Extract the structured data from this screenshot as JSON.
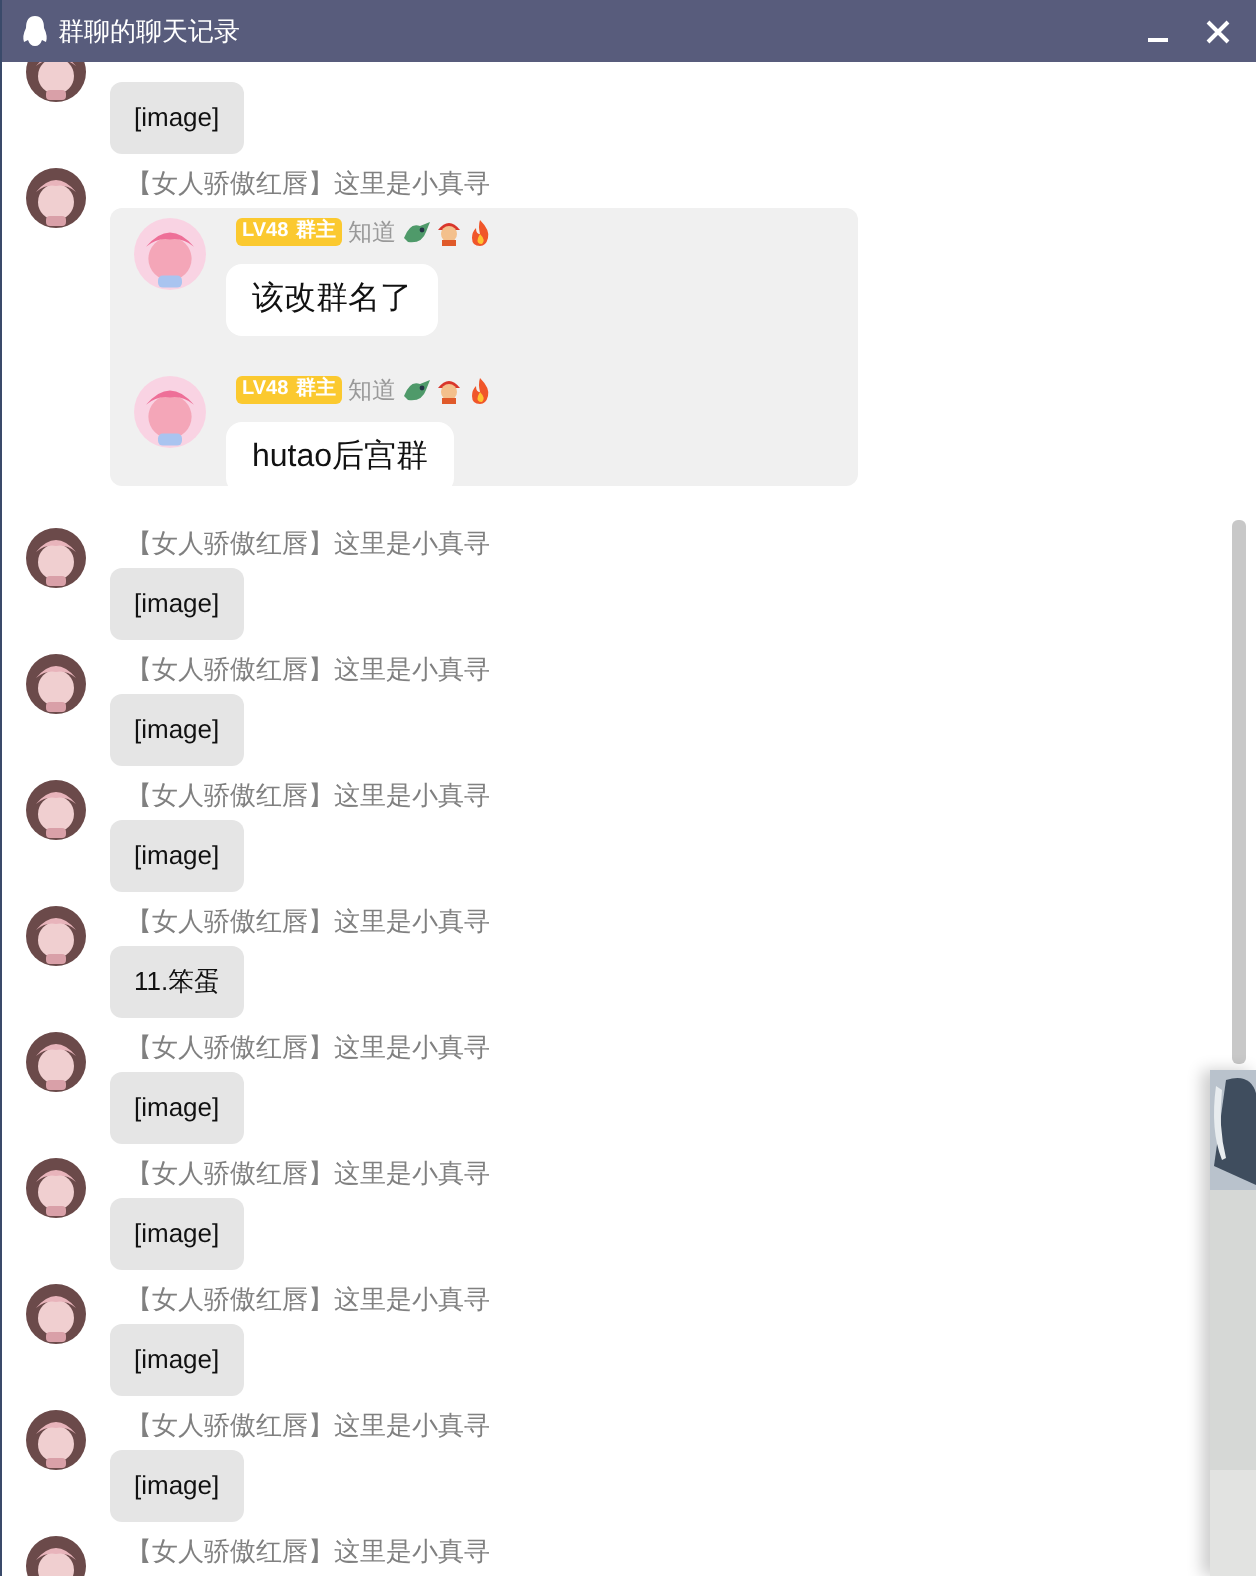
{
  "window": {
    "title": "群聊的聊天记录"
  },
  "messages": [
    {
      "kind": "text",
      "text": "[image]"
    },
    {
      "kind": "forward",
      "sender": "【女人骄傲红唇】这里是小真寻",
      "items": [
        {
          "level": "LV48",
          "role": "群主",
          "name": "知道",
          "text": "该改群名了"
        },
        {
          "level": "LV48",
          "role": "群主",
          "name": "知道",
          "text": "hutao后宫群"
        }
      ]
    },
    {
      "kind": "text",
      "sender": "【女人骄傲红唇】这里是小真寻",
      "text": "[image]"
    },
    {
      "kind": "text",
      "sender": "【女人骄傲红唇】这里是小真寻",
      "text": "[image]"
    },
    {
      "kind": "text",
      "sender": "【女人骄傲红唇】这里是小真寻",
      "text": "[image]"
    },
    {
      "kind": "text",
      "sender": "【女人骄傲红唇】这里是小真寻",
      "text": "11.笨蛋"
    },
    {
      "kind": "text",
      "sender": "【女人骄傲红唇】这里是小真寻",
      "text": "[image]"
    },
    {
      "kind": "text",
      "sender": "【女人骄傲红唇】这里是小真寻",
      "text": "[image]"
    },
    {
      "kind": "text",
      "sender": "【女人骄傲红唇】这里是小真寻",
      "text": "[image]"
    },
    {
      "kind": "text",
      "sender": "【女人骄傲红唇】这里是小真寻",
      "text": "[image]"
    },
    {
      "kind": "text",
      "sender": "【女人骄傲红唇】这里是小真寻"
    }
  ]
}
